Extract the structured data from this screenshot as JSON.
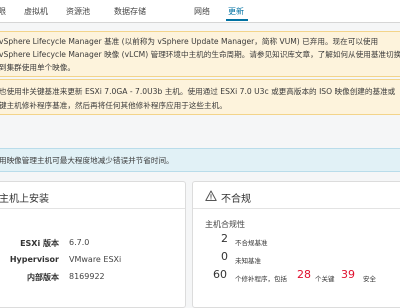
{
  "tabs": [
    {
      "label": "限"
    },
    {
      "label": "虚拟机"
    },
    {
      "label": "资源池"
    },
    {
      "label": "数据存储"
    },
    {
      "label": "网络"
    },
    {
      "label": "更新"
    }
  ],
  "banners": {
    "b1_line1": "vSphere Lifecycle Manager 基准 (以前称为 vSphere Update Manager，简称 VUM) 已弃用。现在可以使用",
    "b1_line2": "vSphere Lifecycle Manager 映像 (vLCM) 管理环境中主机的生命周期。请参见知识库文章，了解如何从使用基准切换",
    "b1_line3": "到集群使用单个映像。",
    "b2_line1": "也使用非关键基准来更新 ESXi 7.0GA - 7.0U3b 主机。使用通过 ESXi 7.0 U3c 或更高版本的 ISO 映像创建的基准或",
    "b2_line2": "键主机修补程序基准，然后再将任何其他修补程序应用于这些主机。",
    "info_line": "用映像管理主机可最大程度地减少错误并节省时间。"
  },
  "install_card": {
    "title": "主机上安装",
    "rows": [
      {
        "label": "ESXi 版本",
        "value": "6.7.0"
      },
      {
        "label": "Hypervisor",
        "value": "VMware ESXi"
      },
      {
        "label": "内部版本",
        "value": "8169922"
      }
    ]
  },
  "compliance_card": {
    "title": "不合规",
    "subtitle": "主机合规性",
    "noncompliant_count": "2",
    "noncompliant_label": "不合规基准",
    "unknown_count": "0",
    "unknown_label": "未知基准",
    "patches_count": "60",
    "patches_label": "个修补程序，包括",
    "critical_count": "28",
    "critical_label": "个关键",
    "security_count": "39",
    "security_label": "安全"
  },
  "colors": {
    "accent": "#0072a3",
    "warning_bg": "#fdf3dc",
    "info_bg": "#e1f1f6",
    "critical": "#e0102e"
  },
  "icons": {
    "compliance": "warning-icon"
  }
}
